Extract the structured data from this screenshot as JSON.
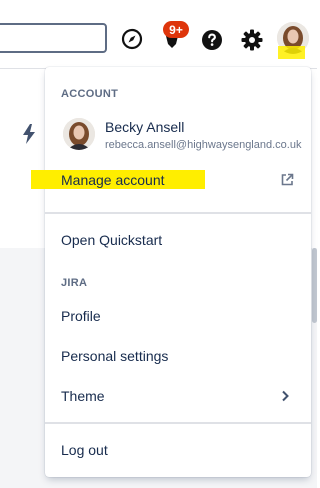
{
  "topbar": {
    "notification_count": "9+",
    "icons": [
      "compass-icon",
      "bell-icon",
      "help-icon",
      "gear-icon"
    ],
    "highlight_color": "#ffee00",
    "badge_color": "#de350b"
  },
  "menu": {
    "account_title": "ACCOUNT",
    "user_name": "Becky Ansell",
    "user_email": "rebecca.ansell@highwaysengland.co.uk",
    "manage_account": "Manage account",
    "open_quickstart": "Open Quickstart",
    "jira_title": "JIRA",
    "profile": "Profile",
    "personal_settings": "Personal settings",
    "theme": "Theme",
    "log_out": "Log out"
  }
}
